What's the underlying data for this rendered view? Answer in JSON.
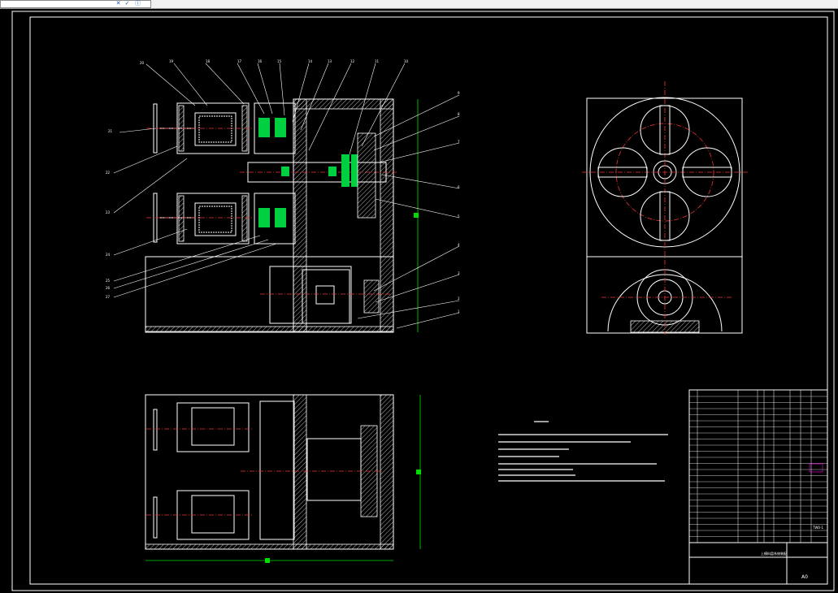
{
  "toolbar": {
    "controls": [
      "✕",
      "✓",
      "ⓘ"
    ]
  },
  "drawing": {
    "sheet_size": "A0",
    "balloon_numbers_top": [
      "20",
      "19",
      "18",
      "17",
      "16",
      "15",
      "14",
      "13",
      "12",
      "11",
      "10"
    ],
    "balloon_numbers_left": [
      "21",
      "22",
      "23",
      "24",
      "25",
      "26",
      "27"
    ],
    "balloon_numbers_right": [
      "9",
      "8",
      "7",
      "6",
      "5",
      "4",
      "3",
      "2",
      "1"
    ],
    "title_block_name": "上模料盘系统装配",
    "parts_list_code": "TW0-1",
    "colors": {
      "background": "#000000",
      "lines": "#ffffff",
      "centerlines": "#e33333",
      "dimensions": "#00dd00",
      "parts": "#00d040",
      "highlight": "#ff00ff"
    }
  }
}
